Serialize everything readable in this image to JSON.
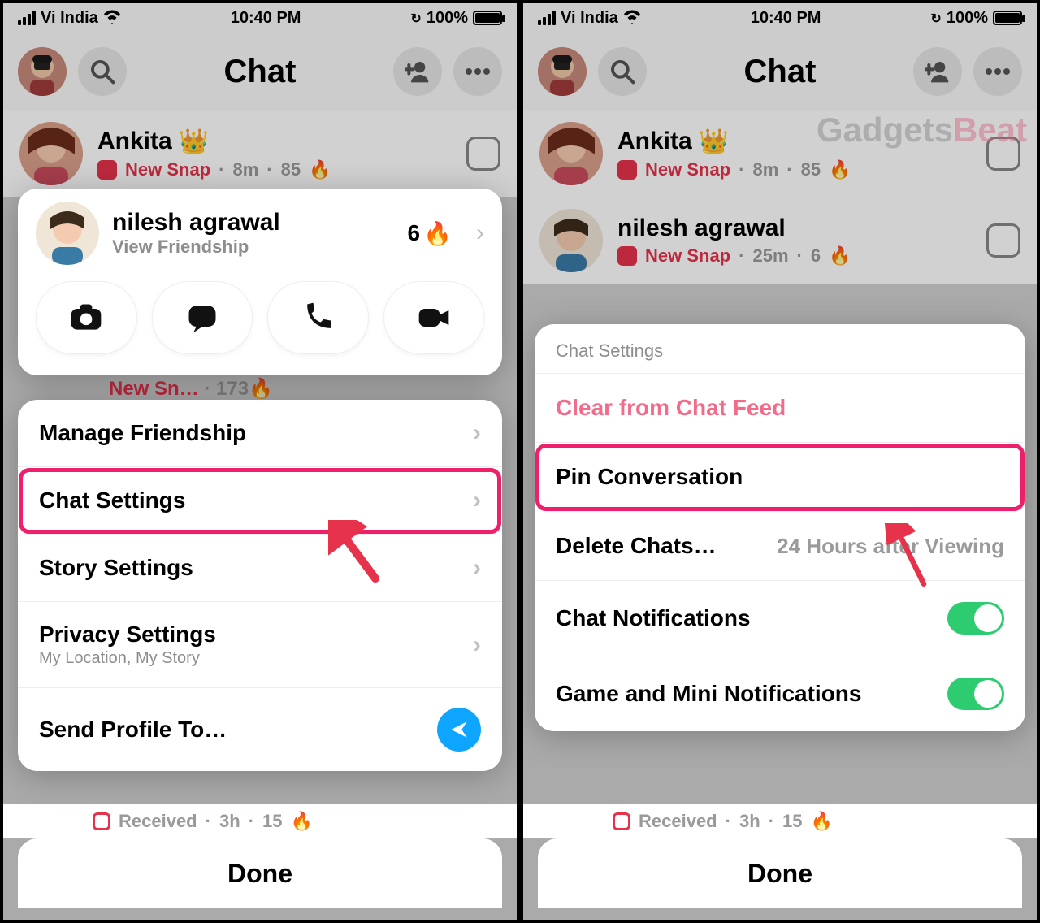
{
  "status": {
    "carrier": "Vi India",
    "time": "10:40 PM",
    "battery": "100%"
  },
  "header": {
    "title": "Chat"
  },
  "watermark": {
    "a": "Gadgets",
    "b": "Beat"
  },
  "chats": {
    "ankita": {
      "name": "Ankita",
      "status": "New Snap",
      "time": "8m",
      "streak": "85",
      "flame": "🔥",
      "crown": "👑"
    },
    "nilesh_left_peek": {
      "status": "New Sn…",
      "streak": "173",
      "flame": "🔥"
    },
    "nilesh_right": {
      "name": "nilesh agrawal",
      "status": "New Snap",
      "time": "25m",
      "streak": "6",
      "flame": "🔥"
    }
  },
  "profile": {
    "name": "nilesh agrawal",
    "sub": "View Friendship",
    "streak": "6",
    "flame": "🔥"
  },
  "menu": {
    "manage": "Manage Friendship",
    "chat_settings": "Chat Settings",
    "story_settings": "Story Settings",
    "privacy": "Privacy Settings",
    "privacy_sub": "My Location, My Story",
    "send_profile": "Send Profile To…"
  },
  "settings": {
    "header": "Chat Settings",
    "clear": "Clear from Chat Feed",
    "pin": "Pin Conversation",
    "delete": "Delete Chats…",
    "delete_val": "24 Hours after Viewing",
    "notif": "Chat Notifications",
    "game_notif": "Game and Mini Notifications"
  },
  "peek_bottom": {
    "label": "Received",
    "time": "3h",
    "streak": "15",
    "flame": "🔥"
  },
  "done": "Done"
}
